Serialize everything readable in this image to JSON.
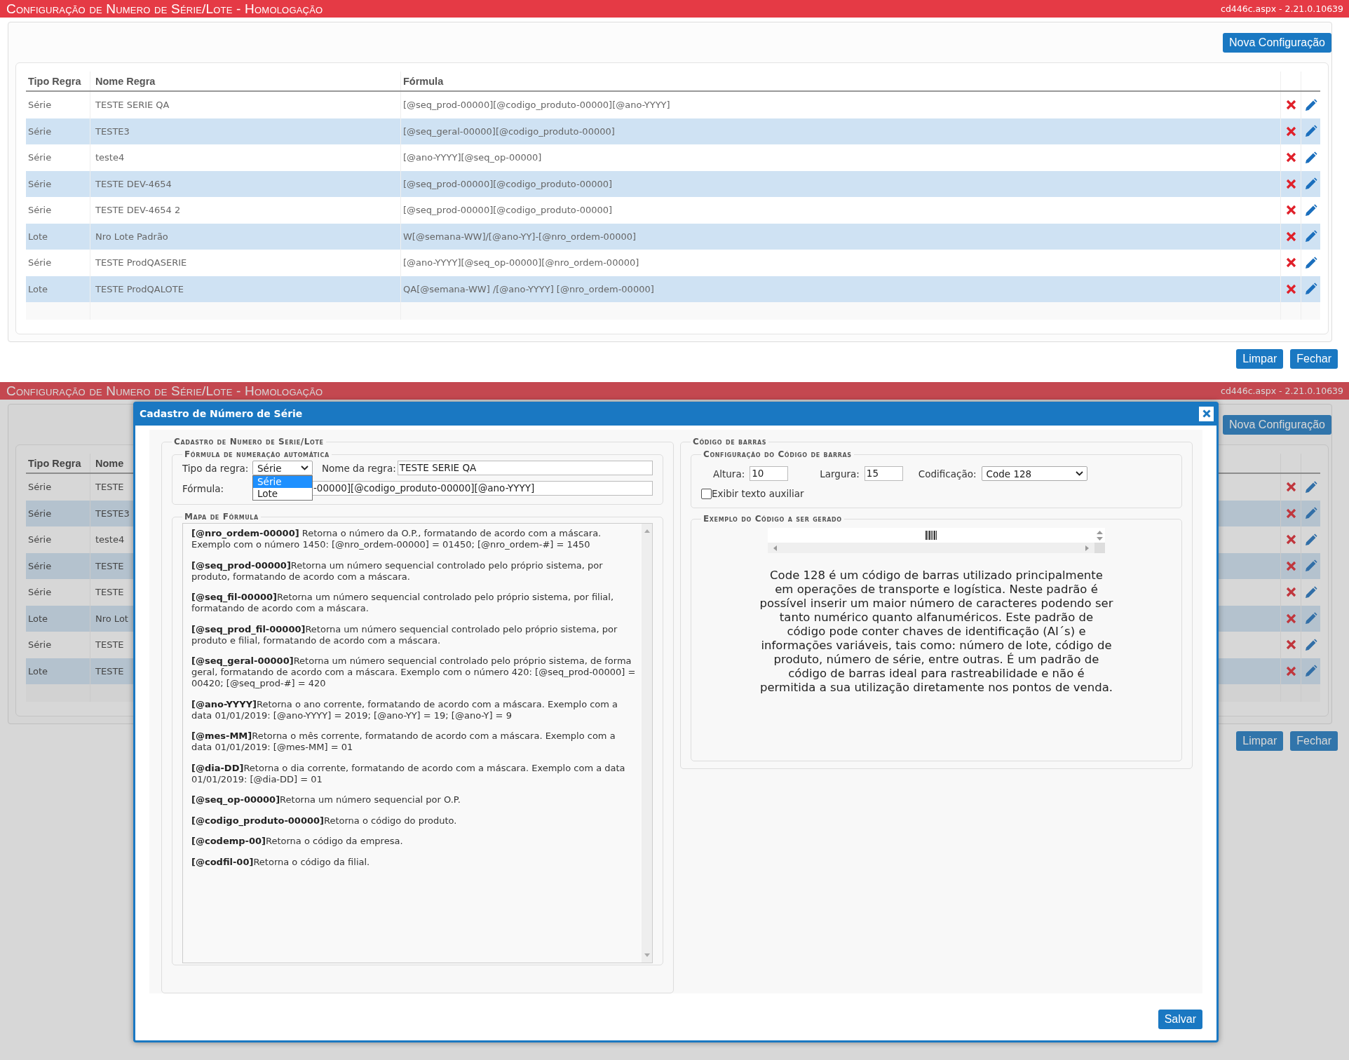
{
  "page": {
    "title": "Configuração de Numero de Série/Lote  - Homologação",
    "version": "cd446c.aspx - 2.21.0.10639",
    "new_button": "Nova Configuração",
    "columns": [
      "Tipo Regra",
      "Nome Regra",
      "Fórmula"
    ],
    "rows": [
      {
        "tipo": "Série",
        "nome": "TESTE SERIE QA",
        "formula": "[@seq_prod-00000][@codigo_produto-00000][@ano-YYYY]"
      },
      {
        "tipo": "Série",
        "nome": "TESTE3",
        "formula": "[@seq_geral-00000][@codigo_produto-00000]"
      },
      {
        "tipo": "Série",
        "nome": "teste4",
        "formula": "[@ano-YYYY][@seq_op-00000]"
      },
      {
        "tipo": "Série",
        "nome": "TESTE DEV-4654",
        "formula": "[@seq_prod-00000][@codigo_produto-00000]"
      },
      {
        "tipo": "Série",
        "nome": "TESTE DEV-4654 2",
        "formula": "[@seq_prod-00000][@codigo_produto-00000]"
      },
      {
        "tipo": "Lote",
        "nome": "Nro Lote Padrão",
        "formula": "W[@semana-WW]/[@ano-YY]-[@nro_ordem-00000]"
      },
      {
        "tipo": "Série",
        "nome": "TESTE ProdQASERIE",
        "formula": "[@ano-YYYY][@seq_op-00000][@nro_ordem-00000]"
      },
      {
        "tipo": "Lote",
        "nome": "TESTE ProdQALOTE",
        "formula": "QA[@semana-WW] /[@ano-YYYY] [@nro_ordem-00000]"
      }
    ],
    "buttons": [
      "Limpar",
      "Fechar"
    ]
  },
  "background_page": {
    "title": "Configuração de Numero de Série/Lote  - Homologação",
    "version": "cd446c.aspx - 2.21.0.10639",
    "new_button": "Nova Configuração",
    "columns": [
      "Tipo Regra",
      "Nome"
    ],
    "rows": [
      {
        "tipo": "Série",
        "nome": "TESTE"
      },
      {
        "tipo": "Série",
        "nome": "TESTE3"
      },
      {
        "tipo": "Série",
        "nome": "teste4"
      },
      {
        "tipo": "Série",
        "nome": "TESTE"
      },
      {
        "tipo": "Série",
        "nome": "TESTE"
      },
      {
        "tipo": "Lote",
        "nome": "Nro Lot"
      },
      {
        "tipo": "Série",
        "nome": "TESTE"
      },
      {
        "tipo": "Lote",
        "nome": "TESTE"
      }
    ],
    "buttons": [
      "Limpar",
      "Fechar"
    ]
  },
  "modal": {
    "title": "Cadastro de Número de Série",
    "left_section": "Cadastro de Numero de Serie/Lote",
    "formula_section": "Fórmula de numeração automática",
    "rule_type": {
      "label": "Tipo da regra:",
      "value": "Série",
      "options": [
        {
          "label": "Série",
          "selected": true
        },
        {
          "label": "Lote",
          "selected": false
        }
      ]
    },
    "rule_name": {
      "label": "Nome da regra:",
      "value": "TESTE SERIE QA"
    },
    "formula": {
      "label": "Fórmula:",
      "value": "-00000][@codigo_produto-00000][@ano-YYYY]"
    },
    "map_section": "Mapa de Fórmula",
    "map": [
      "**[@nro_ordem-00000]** Retorna o número da O.P., formatando de acordo com a máscara. Exemplo com o número 1450: [@nro_ordem-00000] = 01450; [@nro_ordem-#] = 1450",
      "**[@seq_prod-00000]**Retorna um número sequencial controlado pelo próprio sistema, por produto, formatando de acordo com a máscara.",
      "**[@seq_fil-00000]**Retorna um número sequencial controlado pelo próprio sistema, por filial, formatando de acordo com a máscara.",
      "**[@seq_prod_fil-00000]**Retorna um número sequencial controlado pelo próprio sistema, por produto e filial, formatando de acordo com a máscara.",
      "**[@seq_geral-00000]**Retorna um número sequencial controlado pelo próprio sistema, de forma geral, formatando de acordo com a máscara. Exemplo com o número 420: [@seq_prod-00000] = 00420; [@seq_prod-#] = 420",
      "**[@ano-YYYY]**Retorna o ano corrente, formatando de acordo com a máscara. Exemplo com a data 01/01/2019: [@ano-YYYY] = 2019; [@ano-YY] = 19; [@ano-Y] = 9",
      "**[@mes-MM]**Retorna o mês corrente, formatando de acordo com a máscara. Exemplo com a data 01/01/2019: [@mes-MM] = 01",
      "**[@dia-DD]**Retorna o dia corrente, formatando de acordo com a máscara. Exemplo com a data 01/01/2019: [@dia-DD] = 01",
      "**[@seq_op-00000]**Retorna um número sequencial por O.P.",
      "**[@codigo_produto-00000]**Retorna o código do produto.",
      "**[@codemp-00]**Retorna o código da empresa.",
      "**[@codfil-00]**Retorna o código da filial."
    ],
    "barcode_section": "Código de barras",
    "barcode_config_section": "Configuração do Código de barras",
    "height": {
      "label": "Altura:",
      "value": "10"
    },
    "width": {
      "label": "Largura:",
      "value": "15"
    },
    "encoding": {
      "label": "Codificação:",
      "value": "Code 128"
    },
    "auxiliary_text": {
      "label": "Exibir texto auxiliar",
      "checked": false
    },
    "example_section": "Exemplo do Código a ser gerado",
    "description": "Code 128 é um código de barras utilizado principalmente em operações de transporte e logística. Neste padrão é possível inserir um maior número de caracteres podendo ser tanto numérico quanto alfanuméricos. Este padrão de código pode conter chaves de identificação (AI´s) e informações variáveis, tais como: número de lote, código de produto, número de série, entre outras. É um padrão de código de barras ideal para rastreabilidade e não é permitida a sua utilização diretamente nos pontos de venda.",
    "save_button": "Salvar"
  }
}
